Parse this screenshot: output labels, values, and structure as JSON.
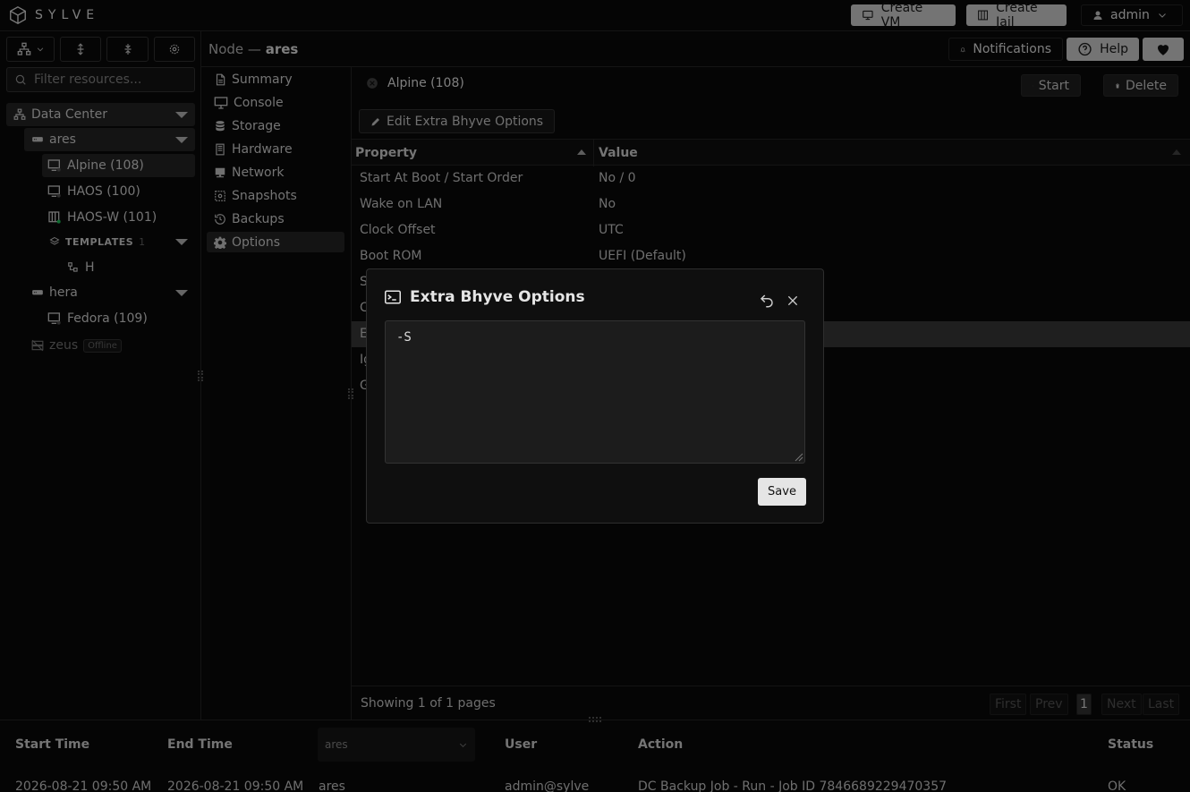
{
  "header": {
    "logo_text": "SYLVE",
    "create_vm": "Create VM",
    "create_jail": "Create Jail",
    "user": "admin"
  },
  "header_right": {
    "notifications": "Notifications",
    "help": "Help"
  },
  "sidebar": {
    "filter_placeholder": "Filter resources...",
    "datacenter": "Data Center",
    "nodes": {
      "ares": "ares",
      "hera": "hera",
      "zeus": "zeus",
      "zeus_status": "Offline"
    },
    "items": {
      "alpine": "Alpine (108)",
      "haos": "HAOS (100)",
      "haosw": "HAOS-W (101)",
      "templates": "TEMPLATES",
      "templates_count": "1",
      "template_h": "H",
      "fedora": "Fedora (109)"
    }
  },
  "node": {
    "prefix": "Node —",
    "name": "ares"
  },
  "nav": [
    "Summary",
    "Console",
    "Storage",
    "Hardware",
    "Network",
    "Snapshots",
    "Backups",
    "Options"
  ],
  "main": {
    "title": "Alpine (108)",
    "start": "Start",
    "delete": "Delete",
    "edit_button": "Edit Extra Bhyve Options",
    "col_property": "Property",
    "col_value": "Value",
    "rows": [
      {
        "p": "Start At Boot / Start Order",
        "v": "No / 0"
      },
      {
        "p": "Wake on LAN",
        "v": "No"
      },
      {
        "p": "Clock Offset",
        "v": "UTC"
      },
      {
        "p": "Boot ROM",
        "v": "UEFI (Default)"
      },
      {
        "p": "S",
        "v": ""
      },
      {
        "p": "C",
        "v": ""
      },
      {
        "p": "E",
        "v": ""
      },
      {
        "p": "Ig",
        "v": ""
      },
      {
        "p": "G",
        "v": ""
      }
    ],
    "showing": "Showing 1 of 1 pages",
    "pager": {
      "first": "First",
      "prev": "Prev",
      "page": "1",
      "next": "Next",
      "last": "Last"
    }
  },
  "log": {
    "h_start": "Start Time",
    "h_end": "End Time",
    "node_select": "ares",
    "h_user": "User",
    "h_action": "Action",
    "h_status": "Status",
    "row": {
      "start": "2026-08-21 09:50 AM",
      "end": "2026-08-21 09:50 AM",
      "node": "ares",
      "user": "admin@sylve",
      "action": "DC Backup Job - Run - Job ID 7846689229470357",
      "status": "OK"
    }
  },
  "modal": {
    "title": "Extra Bhyve Options",
    "value": "-S",
    "save": "Save"
  }
}
